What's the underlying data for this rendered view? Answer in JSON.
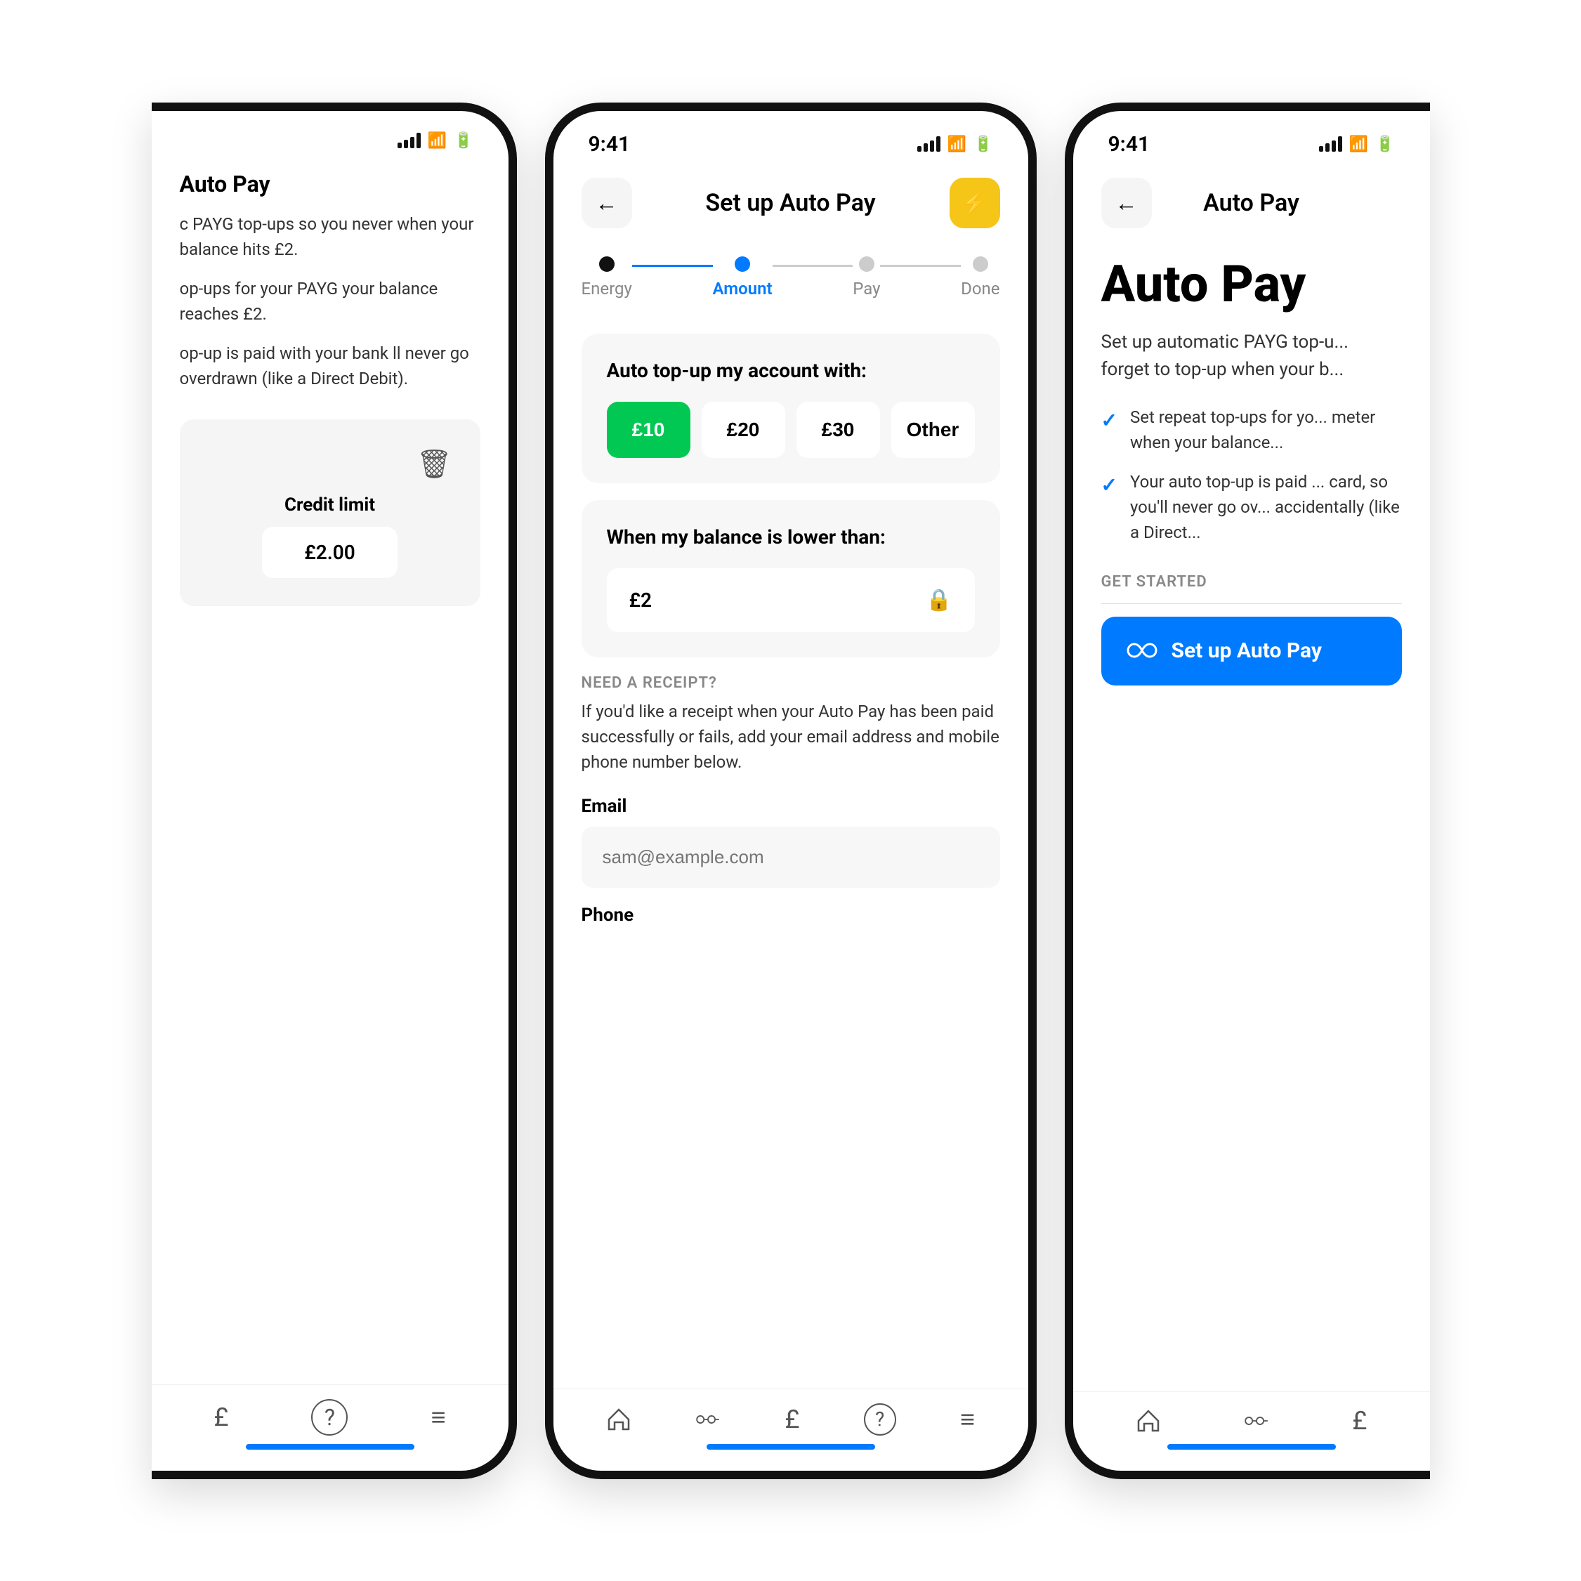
{
  "scene": {
    "bg": "#ffffff"
  },
  "phone_left": {
    "title": "Auto Pay",
    "body1": "c PAYG top-ups so you never when your balance hits £2.",
    "body2": "op-ups for your PAYG your balance reaches £2.",
    "body3": "op-up is paid with your bank ll never go overdrawn (like a Direct Debit).",
    "credit_label": "Credit limit",
    "credit_value": "£2.00",
    "nav_icons": [
      "£",
      "?",
      "≡"
    ]
  },
  "phone_center": {
    "status_time": "9:41",
    "nav_title": "Set up Auto Pay",
    "back_label": "←",
    "lightning": "⚡",
    "steps": [
      {
        "label": "Energy",
        "state": "done"
      },
      {
        "label": "Amount",
        "state": "active"
      },
      {
        "label": "Pay",
        "state": "inactive"
      },
      {
        "label": "Done",
        "state": "inactive"
      }
    ],
    "top_up_title": "Auto top-up my account with:",
    "amounts": [
      {
        "value": "£10",
        "selected": true
      },
      {
        "value": "£20",
        "selected": false
      },
      {
        "value": "£30",
        "selected": false
      },
      {
        "value": "Other",
        "selected": false
      }
    ],
    "balance_title": "When my balance is lower than:",
    "balance_value": "£2",
    "receipt_label": "NEED A RECEIPT?",
    "receipt_desc": "If you'd like a receipt when your Auto Pay has been paid successfully or fails, add your email address and mobile phone number below.",
    "email_label": "Email",
    "email_placeholder": "sam@example.com",
    "phone_label": "Phone",
    "nav_icons": [
      "🏠",
      "⬤⬤⬤",
      "£",
      "?",
      "≡"
    ]
  },
  "phone_right": {
    "status_time": "9:41",
    "nav_title": "Auto Pay",
    "back_label": "←",
    "heading": "Auto Pay",
    "desc": "Set up automatic PAYG top-u... forget to top-up when your b...",
    "checks": [
      "Set repeat top-ups for yo... meter when your balance...",
      "Your auto top-up is paid ... card, so you'll never go ov... accidentally (like a Direct..."
    ],
    "get_started_label": "GET STARTED",
    "setup_btn_text": "Set up Auto Pay",
    "nav_icons": [
      "🏠",
      "⬤⬤⬤",
      "£"
    ]
  }
}
